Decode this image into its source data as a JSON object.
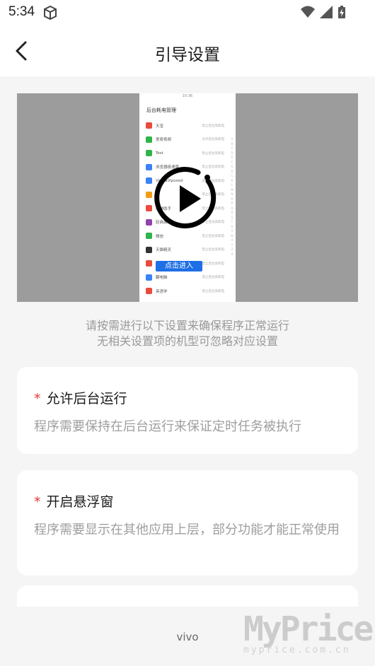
{
  "status": {
    "time": "5:34"
  },
  "header": {
    "title": "引导设置"
  },
  "video": {
    "screenshot": {
      "status_time": "10:36",
      "heading": "后台耗电管理",
      "rows": [
        {
          "name": "天宝",
          "value": "禁止后台高耗电",
          "color": "#e84c3d"
        },
        {
          "name": "爱奇视频",
          "value": "允许后台高耗电",
          "color": "#2fb44a"
        },
        {
          "name": "Test",
          "value": "禁止后台高耗电",
          "color": "#2fb44a"
        },
        {
          "name": "浏览器极速版",
          "value": "禁止后台高耗电",
          "color": "#3b82f6"
        },
        {
          "name": "VirtualXposed",
          "value": "禁止后台高耗电",
          "color": "#3b82f6"
        },
        {
          "name": "手",
          "value": "禁止后台高耗电",
          "color": "#f39c12"
        },
        {
          "name": "闹钟助手",
          "value": "禁止后台高耗电",
          "color": "#e84c3d"
        },
        {
          "name": "轻商城",
          "value": "禁止后台高耗电",
          "color": "#8e44ad"
        },
        {
          "name": "微信",
          "value": "禁止后台高耗电",
          "color": "#2fb44a"
        },
        {
          "name": "天猫精灵",
          "value": "禁止后台高耗电",
          "color": "#333333"
        },
        {
          "name": "小红书",
          "value": "禁止后台高耗电",
          "color": "#e84c3d"
        },
        {
          "name": "翻电脑",
          "value": "禁止后台高耗电",
          "color": "#3b82f6"
        },
        {
          "name": "英语学",
          "value": "禁止后台高耗电",
          "color": "#e84c3d"
        }
      ],
      "alphabet": "A B C D E F G H I J K L M N O P Q R S T U V W X Y Z #"
    },
    "enter_label": "点击进入",
    "play_icon": "play-icon"
  },
  "hint": {
    "line1": "请按需进行以下设置来确保程序正常运行",
    "line2": "无相关设置项的机型可忽略对应设置"
  },
  "cards": [
    {
      "star": "*",
      "title": "允许后台运行",
      "desc": "程序需要保持在后台运行来保证定时任务被执行"
    },
    {
      "star": "*",
      "title": "开启悬浮窗",
      "desc": "程序需要显示在其他应用上层，部分功能才能正常使用"
    }
  ],
  "footer": {
    "brand": "vivo"
  },
  "watermark": {
    "main": "MyPrice",
    "sub": "myprice.com.cn"
  },
  "colors": {
    "accent_red": "#e53935",
    "enter_blue": "#1e6fe6"
  }
}
